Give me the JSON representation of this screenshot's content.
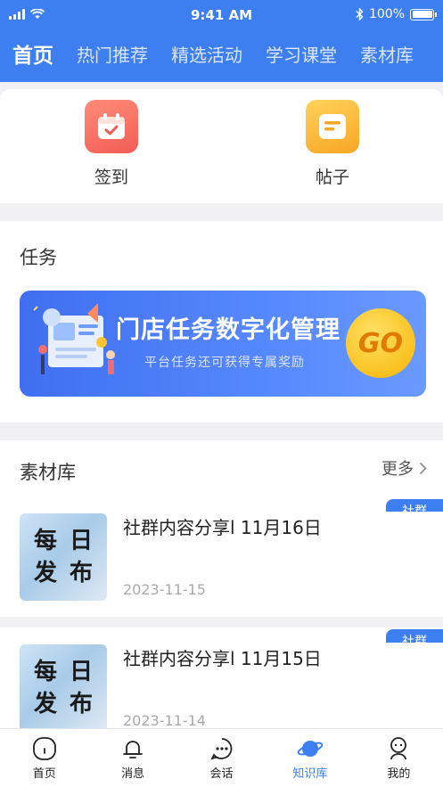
{
  "status_bar": {
    "time": "9:41 AM",
    "battery": "100%"
  },
  "tabs": [
    {
      "label": "首页",
      "active": true
    },
    {
      "label": "热门推荐"
    },
    {
      "label": "精选活动"
    },
    {
      "label": "学习课堂"
    },
    {
      "label": "素材库"
    }
  ],
  "shortcuts": [
    {
      "label": "签到",
      "icon": "calendar-check-icon"
    },
    {
      "label": "帖子",
      "icon": "post-icon"
    }
  ],
  "task": {
    "title": "任务",
    "banner": {
      "title": "门店任务数字化管理",
      "subtitle": "平台任务还可获得专属奖励",
      "go": "GO"
    }
  },
  "materials": {
    "title": "素材库",
    "more": "更多",
    "items": [
      {
        "title": "社群内容分享l 11月16日",
        "date": "2023-11-15",
        "tag": "社群",
        "thumb": [
          "每",
          "日",
          "发",
          "布"
        ]
      },
      {
        "title": "社群内容分享l 11月15日",
        "date": "2023-11-14",
        "tag": "社群",
        "thumb": [
          "每",
          "日",
          "发",
          "布"
        ]
      }
    ]
  },
  "tabbar": [
    {
      "label": "首页",
      "icon": "home-icon"
    },
    {
      "label": "消息",
      "icon": "bell-icon"
    },
    {
      "label": "会话",
      "icon": "chat-icon"
    },
    {
      "label": "知识库",
      "icon": "planet-icon",
      "active": true
    },
    {
      "label": "我的",
      "icon": "user-icon"
    }
  ],
  "colors": {
    "primary": "#3d7ff0",
    "background": "#f1f1f4"
  }
}
